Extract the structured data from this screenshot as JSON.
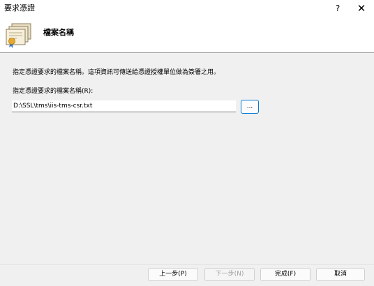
{
  "window": {
    "title": "要求憑證",
    "help_label": "?",
    "close_label": "✕"
  },
  "header": {
    "title": "檔案名稱",
    "icon": "certificate-stack-icon"
  },
  "main": {
    "description": "指定憑證要求的檔案名稱。這項資訊可傳送給憑證授權單位做為簽署之用。",
    "field_label": "指定憑證要求的檔案名稱(R):",
    "filename_value": "D:\\SSL\\tms\\iis-tms-csr.txt",
    "browse_label": "..."
  },
  "footer": {
    "back_label": "上一步(P)",
    "next_label": "下一步(N)",
    "finish_label": "完成(F)",
    "cancel_label": "取消"
  },
  "colors": {
    "accent": "#0078d4",
    "disabled_text": "#a0a0a0"
  }
}
